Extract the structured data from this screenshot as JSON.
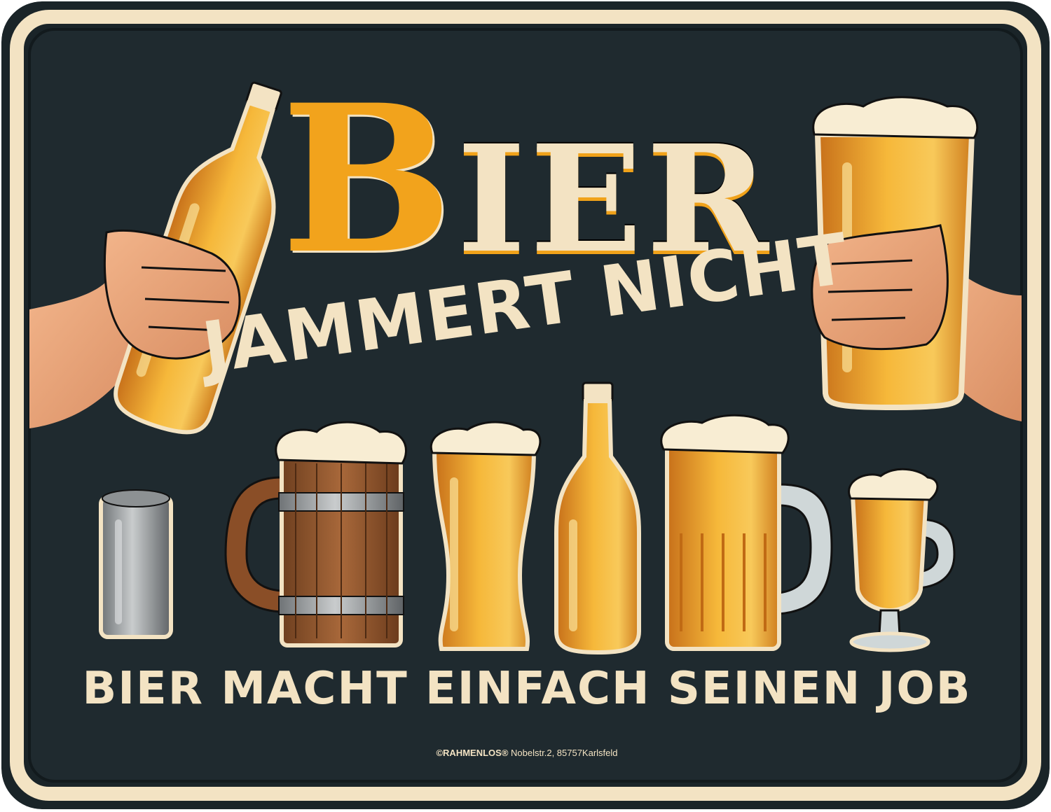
{
  "sign": {
    "title": "Bier",
    "subtitle": "JAMMERT NICHT",
    "tagline": "BIER MACHT EINFACH SEINEN JOB",
    "footer_brand": "©RAHMENLOS®",
    "footer_address": "Nobelstr.2, 85757Karlsfeld"
  },
  "colors": {
    "background": "#1c262b",
    "border": "#f3e3c3",
    "text": "#f3e3c3",
    "accent": "#f2a31c"
  },
  "illustrations": [
    "hand-holding-bottle-icon",
    "hand-holding-glass-icon",
    "beer-can-icon",
    "wooden-tankard-icon",
    "pilsner-glass-icon",
    "beer-bottle-icon",
    "glass-mug-icon",
    "goblet-glass-icon"
  ]
}
